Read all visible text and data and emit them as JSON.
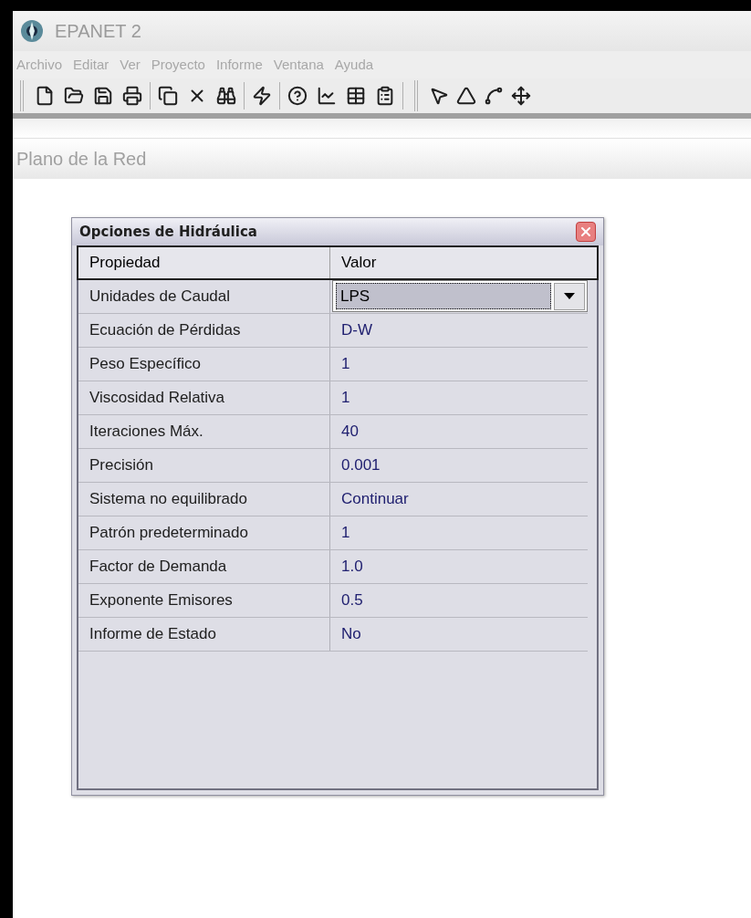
{
  "window": {
    "title": "EPANET 2"
  },
  "menu": [
    "Archivo",
    "Editar",
    "Ver",
    "Proyecto",
    "Informe",
    "Ventana",
    "Ayuda"
  ],
  "map_window": {
    "title": "Plano de la Red"
  },
  "dialog": {
    "title": "Opciones de Hidráulica",
    "columns": [
      "Propiedad",
      "Valor"
    ],
    "rows": [
      {
        "property": "Unidades de Caudal",
        "value": "LPS",
        "kind": "dropdown"
      },
      {
        "property": "Ecuación de Pérdidas",
        "value": "D-W",
        "kind": "text"
      },
      {
        "property": "Peso Específico",
        "value": "1",
        "kind": "text"
      },
      {
        "property": "Viscosidad Relativa",
        "value": "1",
        "kind": "text"
      },
      {
        "property": "Iteraciones Máx.",
        "value": "40",
        "kind": "text"
      },
      {
        "property": "Precisión",
        "value": "0.001",
        "kind": "text"
      },
      {
        "property": "Sistema no equilibrado",
        "value": "Continuar",
        "kind": "text"
      },
      {
        "property": "Patrón predeterminado",
        "value": "1",
        "kind": "text"
      },
      {
        "property": "Factor de Demanda",
        "value": "1.0",
        "kind": "text"
      },
      {
        "property": "Exponente Emisores",
        "value": "0.5",
        "kind": "text"
      },
      {
        "property": "Informe de Estado",
        "value": "No",
        "kind": "text"
      }
    ]
  }
}
